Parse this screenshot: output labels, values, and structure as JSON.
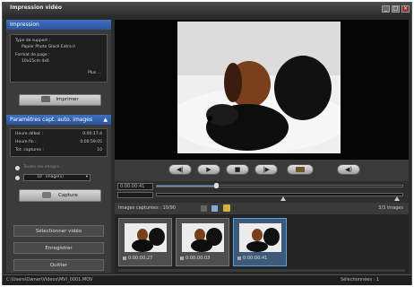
{
  "window": {
    "title": "Impression vidéo",
    "btn_min": "_",
    "btn_max": "□",
    "btn_close": "×"
  },
  "left": {
    "section1_title": "Impression",
    "support_label": "Type de support :",
    "support_value": "Papier Photo Glacé Extra II",
    "format_label": "Format de page :",
    "format_value": "10x15cm 4x6",
    "modify_label": "Plus ...",
    "print_button": "Imprimer",
    "section2_title": "Paramètres capt. auto. images",
    "row1_label": "Heure début :",
    "row1_value": "0:00:17:4",
    "row2_label": "Heure fin :",
    "row2_value": "0:00:59:05",
    "row3_label": "Tot. captures :",
    "row3_value": "10",
    "radio1": "Toutes les images",
    "radio2": "10",
    "radio2_unit": "image(s)",
    "capture_button": "Capture",
    "btn_attach": "Sélectionner vidéo",
    "btn_save": "Enregistrer",
    "btn_exit": "Quitter"
  },
  "controls": {
    "prev": "◀|",
    "play": "▶",
    "stop": "■",
    "next": "|▶",
    "capture_icon": "camera-icon",
    "volume": "◀)"
  },
  "seek": {
    "time": "0:00:00:41",
    "progress": 0.24
  },
  "film": {
    "label": "Images capturées : 10/90",
    "count": "3/3 images",
    "thumbs": [
      {
        "time": "0:00:00:27"
      },
      {
        "time": "0:00:00:03"
      },
      {
        "time": "0:00:00:41"
      }
    ]
  },
  "status": {
    "path": "C:\\Users\\Owner\\Videos\\MVI_0001.MOV",
    "right": "Sélectionnées : 1"
  }
}
